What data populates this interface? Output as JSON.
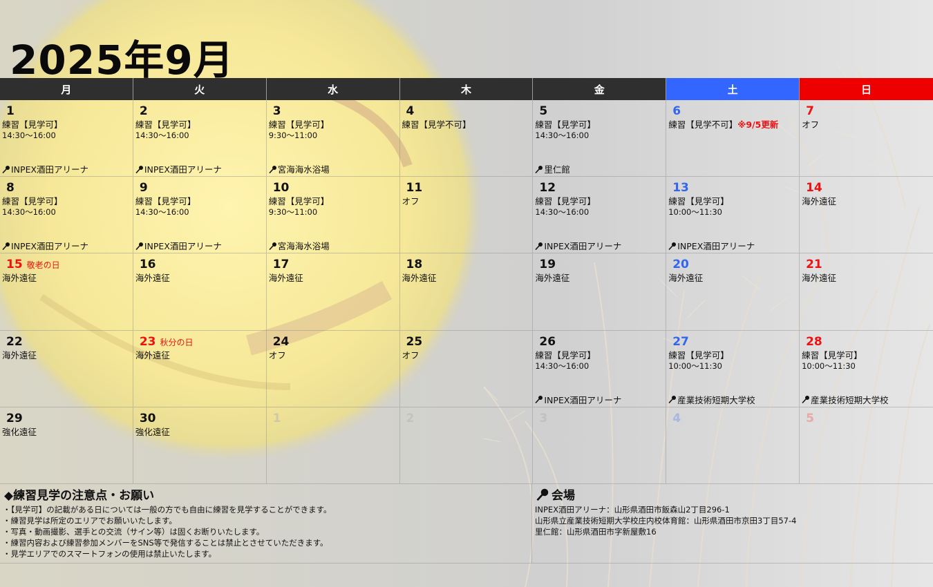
{
  "title": "2025年9月",
  "weekdays": [
    {
      "label": "月",
      "kind": ""
    },
    {
      "label": "火",
      "kind": ""
    },
    {
      "label": "水",
      "kind": ""
    },
    {
      "label": "木",
      "kind": ""
    },
    {
      "label": "金",
      "kind": ""
    },
    {
      "label": "土",
      "kind": "sat"
    },
    {
      "label": "日",
      "kind": "sun"
    }
  ],
  "weeks": [
    [
      {
        "day": "1",
        "act": "練習【見学可】",
        "time": "14:30～16:00",
        "venue": "INPEX酒田アリーナ"
      },
      {
        "day": "2",
        "act": "練習【見学可】",
        "time": "14:30～16:00",
        "venue": "INPEX酒田アリーナ"
      },
      {
        "day": "3",
        "act": "練習【見学可】",
        "time": "9:30～11:00",
        "venue": "宮海海水浴場"
      },
      {
        "day": "4",
        "act": "練習【見学不可】"
      },
      {
        "day": "5",
        "act": "練習【見学可】",
        "time": "14:30～16:00",
        "venue": "里仁館"
      },
      {
        "day": "6",
        "act": "練習【見学不可】",
        "note": "※9/5更新"
      },
      {
        "day": "7",
        "act": "オフ"
      }
    ],
    [
      {
        "day": "8",
        "act": "練習【見学可】",
        "time": "14:30～16:00",
        "venue": "INPEX酒田アリーナ"
      },
      {
        "day": "9",
        "act": "練習【見学可】",
        "time": "14:30～16:00",
        "venue": "INPEX酒田アリーナ"
      },
      {
        "day": "10",
        "act": "練習【見学可】",
        "time": "9:30～11:00",
        "venue": "宮海海水浴場"
      },
      {
        "day": "11",
        "act": "オフ"
      },
      {
        "day": "12",
        "act": "練習【見学可】",
        "time": "14:30～16:00",
        "venue": "INPEX酒田アリーナ"
      },
      {
        "day": "13",
        "act": "練習【見学可】",
        "time": "10:00～11:30",
        "venue": "INPEX酒田アリーナ"
      },
      {
        "day": "14",
        "act": "海外遠征"
      }
    ],
    [
      {
        "day": "15",
        "holiday": "敬老の日",
        "act": "海外遠征"
      },
      {
        "day": "16",
        "act": "海外遠征"
      },
      {
        "day": "17",
        "act": "海外遠征"
      },
      {
        "day": "18",
        "act": "海外遠征"
      },
      {
        "day": "19",
        "act": "海外遠征"
      },
      {
        "day": "20",
        "act": "海外遠征"
      },
      {
        "day": "21",
        "act": "海外遠征"
      }
    ],
    [
      {
        "day": "22",
        "act": "海外遠征"
      },
      {
        "day": "23",
        "holiday": "秋分の日",
        "act": "海外遠征"
      },
      {
        "day": "24",
        "act": "オフ"
      },
      {
        "day": "25",
        "act": "オフ"
      },
      {
        "day": "26",
        "act": "練習【見学可】",
        "time": "14:30～16:00",
        "venue": "INPEX酒田アリーナ"
      },
      {
        "day": "27",
        "act": "練習【見学可】",
        "time": "10:00～11:30",
        "venue": "産業技術短期大学校"
      },
      {
        "day": "28",
        "act": "練習【見学可】",
        "time": "10:00～11:30",
        "venue": "産業技術短期大学校"
      }
    ],
    [
      {
        "day": "29",
        "act": "強化遠征"
      },
      {
        "day": "30",
        "act": "強化遠征"
      },
      {
        "day": "1",
        "faded": true
      },
      {
        "day": "2",
        "faded": true
      },
      {
        "day": "3",
        "faded": true
      },
      {
        "day": "4",
        "faded": true
      },
      {
        "day": "5",
        "faded": true
      }
    ]
  ],
  "notes": {
    "title": "◆練習見学の注意点・お願い",
    "items": [
      "・【見学可】の記載がある日については一般の方でも自由に練習を見学することができます。",
      "・練習見学は所定のエリアでお願いいたします。",
      "・写真・動画撮影、選手との交流（サイン等）は固くお断りいたします。",
      "・練習内容および練習参加メンバーをSNS等で発信することは禁止とさせていただきます。",
      "・見学エリアでのスマートフォンの使用は禁止いたします。"
    ]
  },
  "venues": {
    "title": "会場",
    "items": [
      "INPEX酒田アリーナ：山形県酒田市飯森山2丁目296-1",
      "山形県立産業技術短期大学校庄内校体育館：山形県酒田市京田3丁目57-4",
      "里仁館：山形県酒田市字新屋敷16"
    ]
  }
}
